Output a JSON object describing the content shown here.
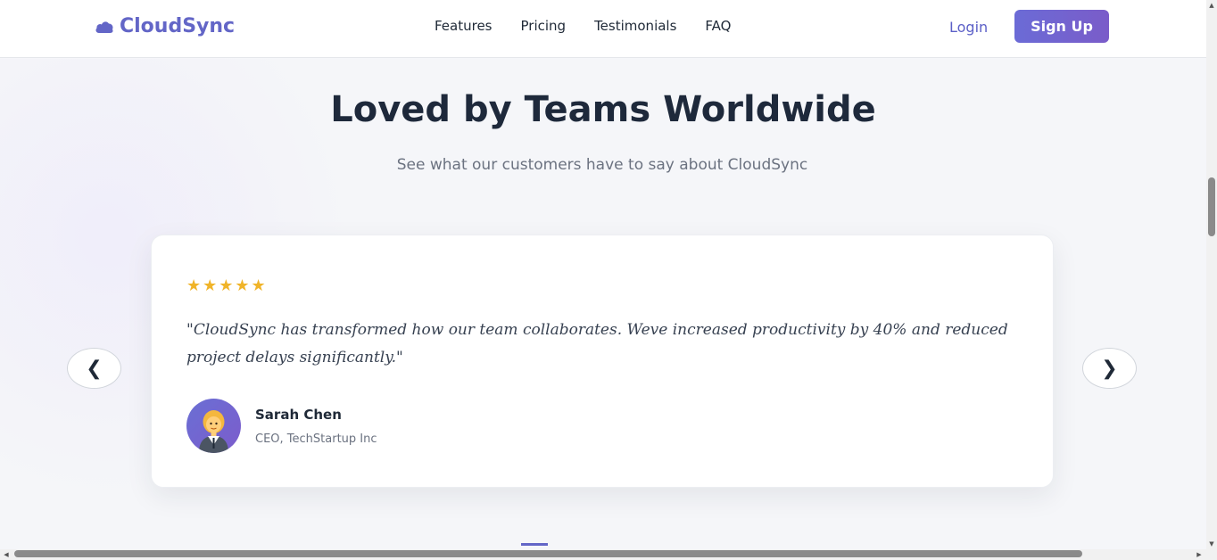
{
  "header": {
    "brand": "CloudSync",
    "nav": [
      {
        "label": "Features"
      },
      {
        "label": "Pricing"
      },
      {
        "label": "Testimonials"
      },
      {
        "label": "FAQ"
      }
    ],
    "login_label": "Login",
    "signup_label": "Sign Up"
  },
  "hero": {
    "title": "Loved by Teams Worldwide",
    "subtitle": "See what our customers have to say about CloudSync"
  },
  "testimonial": {
    "rating": 5,
    "stars": "★★★★★",
    "quote": "\"CloudSync has transformed how our team collaborates. Weve increased productivity by 40% and reduced project delays significantly.\"",
    "author_name": "Sarah Chen",
    "author_role": "CEO, TechStartup Inc"
  },
  "carousel": {
    "prev_label": "❮",
    "next_label": "❯"
  },
  "colors": {
    "brand": "#6366c7",
    "star": "#f0b429",
    "title": "#1e293b"
  },
  "icons": {
    "logo": "cloud-icon",
    "avatar": "woman-office-worker-icon"
  }
}
